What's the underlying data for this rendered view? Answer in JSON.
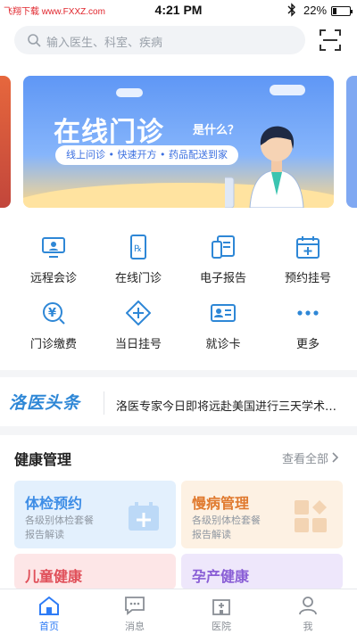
{
  "status": {
    "watermark": "飞翔下载 www.FXXZ.com",
    "time": "4:21 PM",
    "battery": "22%"
  },
  "search": {
    "placeholder": "输入医生、科室、疾病"
  },
  "banner": {
    "title": "在线门诊",
    "question": "是什么？",
    "tagline": "线上问诊 • 快速开方 • 药品配送到家"
  },
  "services": [
    {
      "label": "远程会诊",
      "icon": "remote-consult-icon"
    },
    {
      "label": "在线门诊",
      "icon": "online-clinic-icon"
    },
    {
      "label": "电子报告",
      "icon": "e-report-icon"
    },
    {
      "label": "预约挂号",
      "icon": "appointment-icon"
    },
    {
      "label": "门诊缴费",
      "icon": "payment-icon"
    },
    {
      "label": "当日挂号",
      "icon": "same-day-register-icon"
    },
    {
      "label": "就诊卡",
      "icon": "medical-card-icon"
    },
    {
      "label": "更多",
      "icon": "more-icon"
    }
  ],
  "news": {
    "logo": "洛医头条",
    "headline": "洛医专家今日即将远赴美国进行三天学术交..."
  },
  "health": {
    "title": "健康管理",
    "more": "查看全部",
    "cards": [
      {
        "title": "体检预约",
        "line1": "各级别体检套餐",
        "line2": "报告解读",
        "color": "#3d8de6"
      },
      {
        "title": "慢病管理",
        "line1": "各级别体检套餐",
        "line2": "报告解读",
        "color": "#e07a2f"
      },
      {
        "title": "儿童健康",
        "line1": "",
        "line2": "",
        "color": "#e0505a"
      },
      {
        "title": "孕产健康",
        "line1": "",
        "line2": "",
        "color": "#8a5fd6"
      }
    ]
  },
  "tabs": [
    {
      "label": "首页",
      "icon": "home-icon",
      "active": true
    },
    {
      "label": "消息",
      "icon": "message-icon",
      "active": false
    },
    {
      "label": "医院",
      "icon": "hospital-icon",
      "active": false
    },
    {
      "label": "我",
      "icon": "profile-icon",
      "active": false
    }
  ],
  "colors": {
    "accent": "#2e7cf6",
    "icon_blue": "#2e87d6"
  }
}
